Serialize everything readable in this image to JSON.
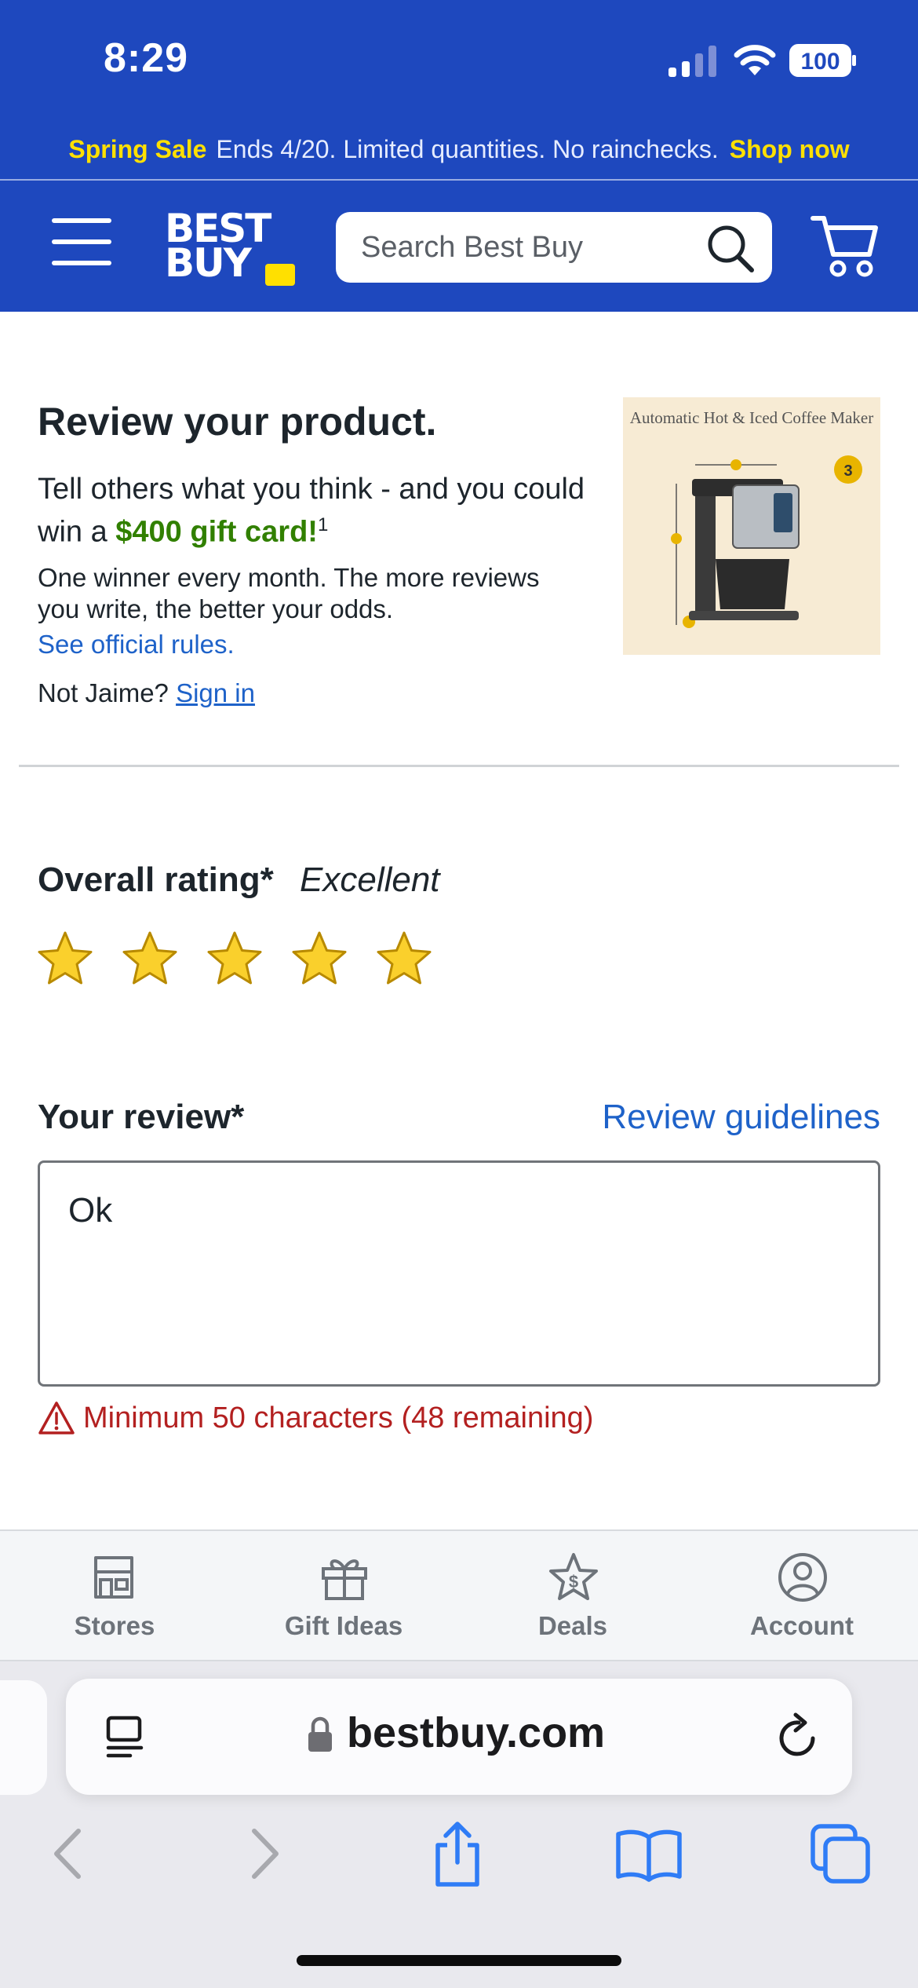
{
  "status_bar": {
    "time": "8:29",
    "battery": "100"
  },
  "promo": {
    "highlight": "Spring Sale",
    "text": "Ends 4/20. Limited quantities. No rainchecks.",
    "link": "Shop now"
  },
  "header": {
    "logo_line1": "BEST",
    "logo_line2": "BUY",
    "search_placeholder": "Search Best Buy"
  },
  "intro": {
    "title": "Review your product.",
    "subtitle_pre": "Tell others what you think - and you could win a ",
    "prize": "$400 gift card!",
    "footnote": "1",
    "winner_text": "One winner every month. The more reviews you write, the better your odds.",
    "rules_link": "See official rules.",
    "not_user_prefix": "Not Jaime?",
    "sign_in": "Sign in"
  },
  "product_image": {
    "caption": "Automatic Hot & Iced Coffee Maker",
    "badge": "3"
  },
  "rating": {
    "label": "Overall rating*",
    "value_text": "Excellent",
    "stars_selected": 5,
    "stars_total": 5
  },
  "review": {
    "label": "Your review*",
    "guidelines_link": "Review guidelines",
    "text": "Ok",
    "error": "Minimum 50 characters (48 remaining)"
  },
  "tabbar": {
    "items": [
      {
        "label": "Stores",
        "icon": "store-icon"
      },
      {
        "label": "Gift Ideas",
        "icon": "gift-icon"
      },
      {
        "label": "Deals",
        "icon": "deals-star-icon"
      },
      {
        "label": "Account",
        "icon": "account-icon"
      }
    ]
  },
  "browser": {
    "url": "bestbuy.com"
  },
  "colors": {
    "brand_blue": "#1e48be",
    "brand_yellow": "#ffe000",
    "link_blue": "#1e62c9",
    "error_red": "#b32020",
    "prize_green": "#318000",
    "star_gold": "#fad02c"
  }
}
